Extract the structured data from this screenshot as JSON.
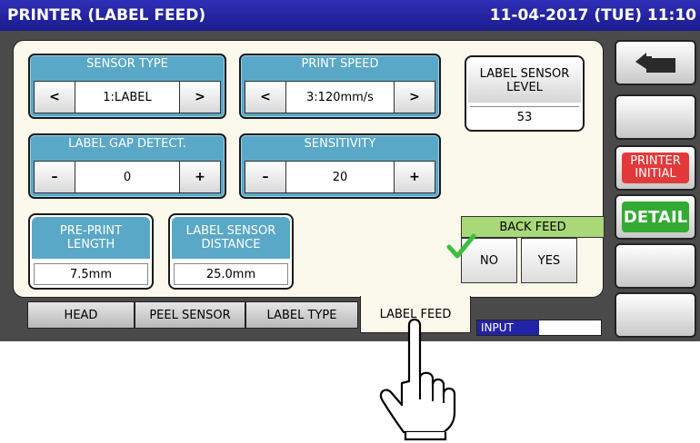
{
  "header": {
    "title": "PRINTER (LABEL FEED)",
    "datetime": "11-04-2017 (TUE) 11:10"
  },
  "sensor_type": {
    "label": "SENSOR TYPE",
    "value": "1:LABEL",
    "left": "<",
    "right": ">"
  },
  "print_speed": {
    "label": "PRINT SPEED",
    "value": "3:120mm/s",
    "left": "<",
    "right": ">"
  },
  "label_gap": {
    "label": "LABEL GAP DETECT.",
    "value": "0",
    "minus": "–",
    "plus": "+"
  },
  "sensitivity": {
    "label": "SENSITIVITY",
    "value": "20",
    "minus": "–",
    "plus": "+"
  },
  "sensor_level": {
    "label_line1": "LABEL SENSOR",
    "label_line2": "LEVEL",
    "value": "53"
  },
  "pre_print": {
    "label_line1": "PRE-PRINT",
    "label_line2": "LENGTH",
    "value": "7.5mm"
  },
  "sensor_distance": {
    "label_line1": "LABEL SENSOR",
    "label_line2": "DISTANCE",
    "value": "25.0mm"
  },
  "back_feed": {
    "label": "BACK FEED",
    "no": "NO",
    "yes": "YES",
    "selected": "NO"
  },
  "side": {
    "printer_initial_1": "PRINTER",
    "printer_initial_2": "INITIAL",
    "detail": "DETAIL"
  },
  "tabs": [
    "HEAD",
    "PEEL SENSOR",
    "LABEL TYPE",
    "LABEL FEED"
  ],
  "active_tab": "LABEL FEED",
  "input_bar": {
    "label": "INPUT",
    "progress": 0.47
  },
  "colors": {
    "title_bg": "#1b1b8e",
    "group_header": "#5aa8c8",
    "back_feed_header": "#a8d878",
    "printer_initial": "#e23a3a",
    "detail": "#33aa33",
    "check": "#3bbf3b"
  },
  "icons": [
    "back-arrow-icon",
    "checkmark-icon",
    "pointing-hand-icon"
  ]
}
